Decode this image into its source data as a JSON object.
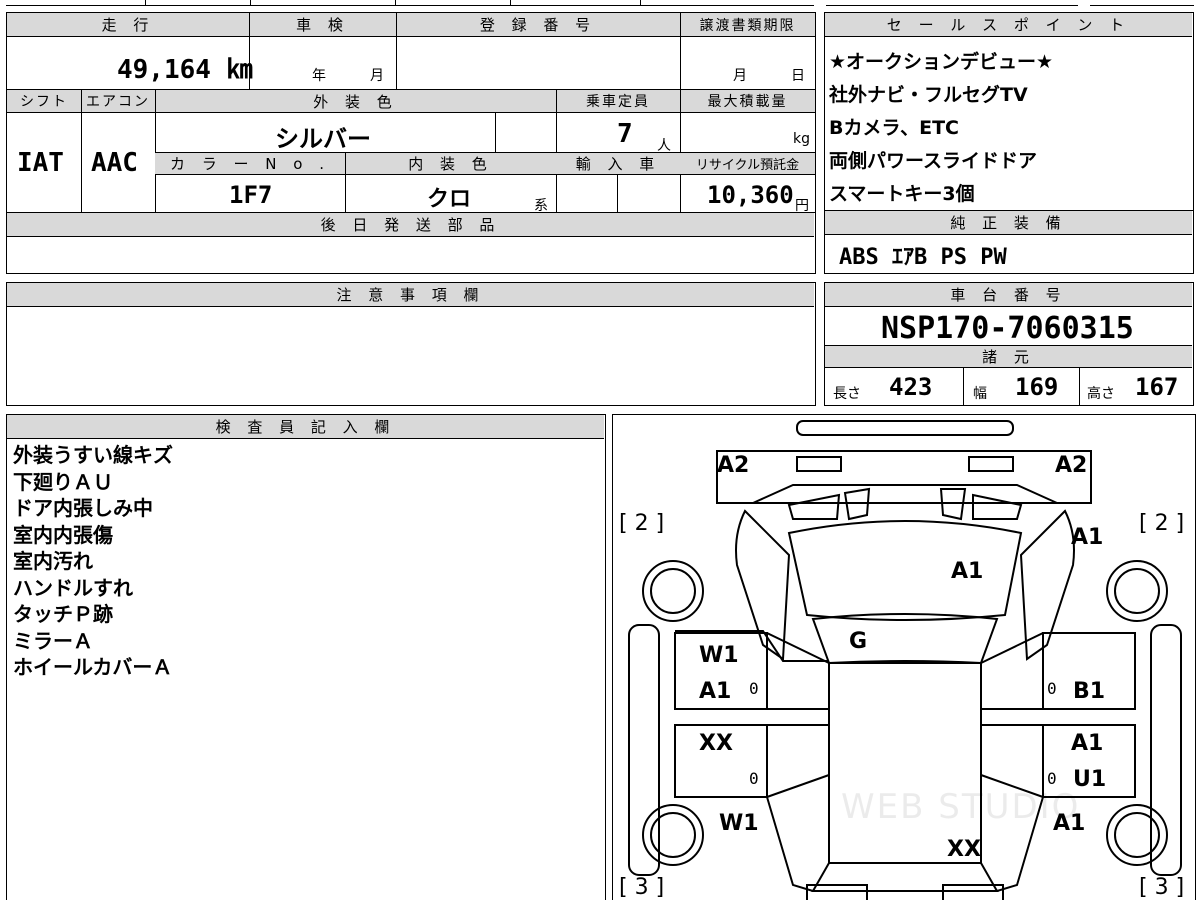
{
  "vehicle": {
    "mileage_label": "走 行",
    "mileage": "49,164 ㎞",
    "inspection_label": "車 検",
    "inspection_year": "年",
    "inspection_month": "月",
    "registration_label": "登 録 番 号",
    "transfer_label": "譲渡書類期限",
    "transfer_month": "月",
    "transfer_day": "日",
    "shift_label": "シフト",
    "shift": "IAT",
    "ac_label": "エアコン",
    "ac": "AAC",
    "exterior_color_label": "外 装 色",
    "exterior_color": "シルバー",
    "color_no_label": "カ ラ ー N o .",
    "color_no": "1F7",
    "interior_color_label": "内 装 色",
    "interior_color": "クロ",
    "interior_suffix": "系",
    "capacity_label": "乗車定員",
    "capacity": "7",
    "capacity_unit": "人",
    "max_load_label": "最大積載量",
    "max_load_unit": "kg",
    "import_label": "輸 入 車",
    "recycle_label": "リサイクル預託金",
    "recycle": "10,360",
    "recycle_unit": "円"
  },
  "later_parts_label": "後 日 発 送 部 品",
  "sales_points": {
    "label": "セ ー ル ス ポ イ ン ト",
    "items": [
      "★オークションデビュー★",
      "社外ナビ・フルセグTV",
      "Bカメラ、ETC",
      "両側パワースライドドア",
      "スマートキー3個"
    ]
  },
  "standard_equipment": {
    "label": "純 正 装 備",
    "value": "ABS ｴｱB PS PW"
  },
  "caution_label": "注 意 事 項 欄",
  "chassis": {
    "label": "車 台 番 号",
    "number": "NSP170-7060315",
    "spec_label": "諸 元",
    "length_label": "長さ",
    "length": "423",
    "width_label": "幅",
    "width": "169",
    "height_label": "高さ",
    "height": "167"
  },
  "inspector": {
    "label": "検 査 員 記 入 欄",
    "notes": [
      "外装うすい線キズ",
      "下廻りＡＵ",
      "ドア内張しみ中",
      "室内内張傷",
      "室内汚れ",
      "ハンドルすれ",
      "タッチＰ跡",
      "ミラーＡ",
      "ホイールカバーＡ"
    ]
  },
  "diagram": {
    "marks": {
      "front_left_corner": "A2",
      "front_right_corner": "A2",
      "tire_front_left": "[ 2 ]",
      "tire_front_right": "[ 2 ]",
      "tire_rear_left": "[ 3 ]",
      "tire_rear_right": "[ 3 ]",
      "front_right_fender": "A1",
      "hood": "A1",
      "windshield": "G",
      "left_front_door_top": "W1",
      "left_front_door": "A1",
      "left_rear_door": "XX",
      "left_rear_quarter": "W1",
      "right_front_door": "B1",
      "right_rear_door_top": "A1",
      "right_rear_door": "U1",
      "right_rear_quarter": "A1",
      "roof_rear": "XX"
    },
    "zero_marks": [
      "0",
      "0",
      "0",
      "0"
    ],
    "watermark": "WEB STUDIO"
  }
}
